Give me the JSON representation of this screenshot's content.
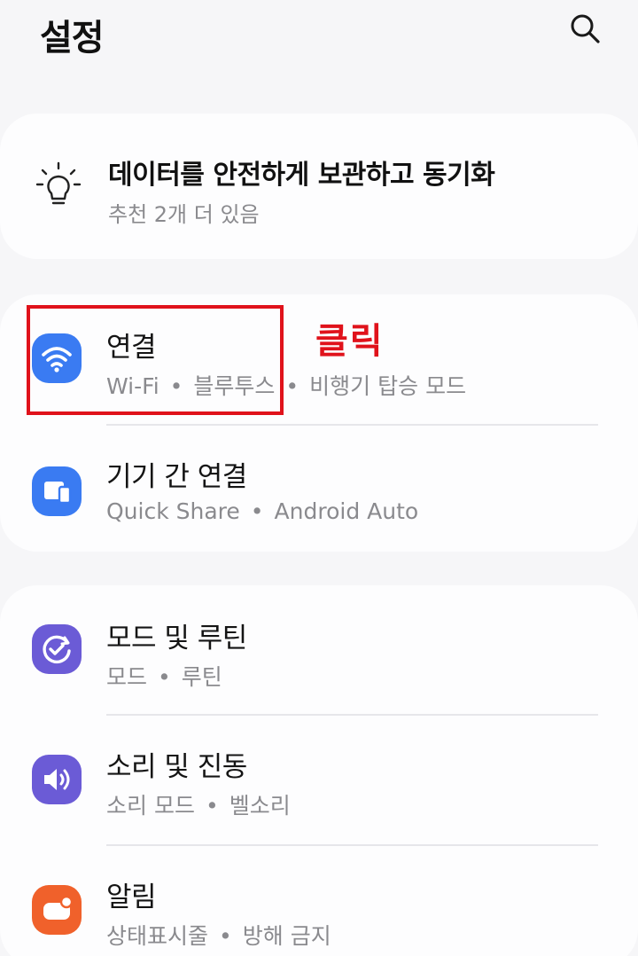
{
  "header": {
    "title": "설정"
  },
  "tip_card": {
    "title": "데이터를 안전하게 보관하고 동기화",
    "subtitle": "추천 2개 더 있음"
  },
  "settings": [
    {
      "title": "연결",
      "subtitle": [
        "Wi-Fi",
        "블루투스",
        "비행기 탑승 모드"
      ],
      "icon": "wifi-icon",
      "icon_color": "#3a7bf2"
    },
    {
      "title": "기기 간 연결",
      "subtitle": [
        "Quick Share",
        "Android Auto"
      ],
      "icon": "devices-icon",
      "icon_color": "#3a7bf2"
    },
    {
      "title": "모드 및 루틴",
      "subtitle": [
        "모드",
        "루틴"
      ],
      "icon": "modes-routines-icon",
      "icon_color": "#6b5bd6"
    },
    {
      "title": "소리 및 진동",
      "subtitle": [
        "소리 모드",
        "벨소리"
      ],
      "icon": "speaker-icon",
      "icon_color": "#6b5bd6"
    },
    {
      "title": "알림",
      "subtitle": [
        "상태표시줄",
        "방해 금지"
      ],
      "icon": "notification-icon",
      "icon_color": "#f0612b"
    }
  ],
  "separator": "•",
  "annotation": {
    "label": "클릭",
    "color": "#e0121b"
  }
}
